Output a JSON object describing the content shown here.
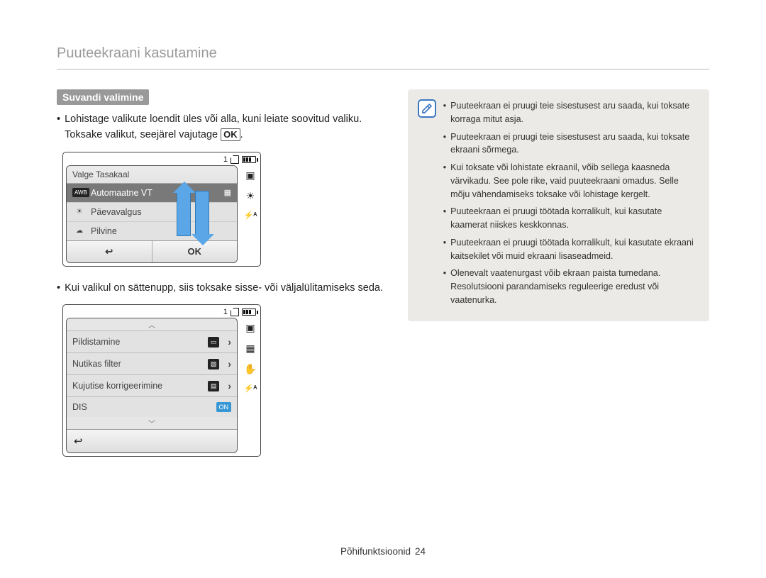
{
  "page_title": "Puuteekraani kasutamine",
  "section_heading": "Suvandi valimine",
  "intro_line_pre": "Lohistage valikute loendit üles või alla, kuni leiate soovitud valiku. Toksake valikut, seejärel vajutage ",
  "intro_ok": "OK",
  "intro_line_post": ".",
  "screen1": {
    "topbar_count": "1",
    "panel_title": "Valge Tasakaal",
    "items": [
      {
        "icon_label": "AWB",
        "label": "Automaatne VT",
        "selected": true
      },
      {
        "icon_label": "",
        "label": "Päevavalgus",
        "selected": false
      },
      {
        "icon_label": "",
        "label": "Pilvine",
        "selected": false
      }
    ],
    "footer_back": "↩",
    "footer_ok": "OK",
    "side_icons": [
      "sd",
      "brightness",
      "flash"
    ]
  },
  "mid_text": "Kui valikul on sättenupp, siis toksake sisse- või väljalülitamiseks seda.",
  "screen2": {
    "topbar_count": "1",
    "rows": [
      {
        "label": "Pildistamine",
        "badge": "res",
        "chevron": "›"
      },
      {
        "label": "Nutikas filter",
        "badge": "filt",
        "chevron": "›"
      },
      {
        "label": "Kujutise korrigeerimine",
        "badge": "adj",
        "chevron": "›"
      },
      {
        "label": "DIS",
        "badge": "ON",
        "on": true
      }
    ],
    "footer_back": "↩",
    "side_icons": [
      "sd",
      "res",
      "stab",
      "flash"
    ]
  },
  "notes": [
    "Puuteekraan ei pruugi teie sisestusest aru saada, kui toksate korraga mitut asja.",
    "Puuteekraan ei pruugi teie sisestusest aru saada, kui toksate ekraani sõrmega.",
    "Kui toksate või lohistate ekraanil, võib sellega kaasneda värvikadu. See pole rike, vaid puuteekraani omadus. Selle mõju vähendamiseks toksake või lohistage kergelt.",
    "Puuteekraan ei pruugi töötada korralikult, kui kasutate kaamerat niiskes keskkonnas.",
    "Puuteekraan ei pruugi töötada korralikult, kui kasutate ekraani kaitsekilet või muid ekraani lisaseadmeid.",
    "Olenevalt vaatenurgast võib ekraan paista tumedana. Resolutsiooni parandamiseks reguleerige eredust või vaatenurka."
  ],
  "footer_section": "Põhifunktsioonid",
  "footer_page": "24"
}
